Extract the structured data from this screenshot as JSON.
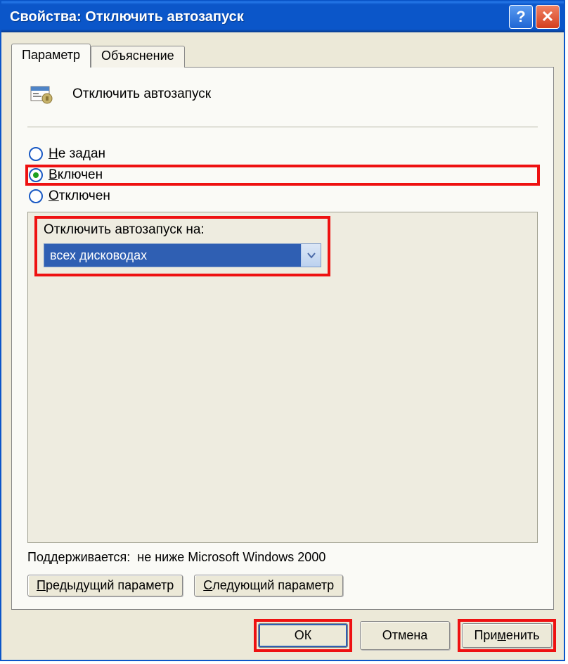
{
  "titlebar": {
    "text": "Свойства: Отключить автозапуск"
  },
  "tabs": {
    "parameter": "Параметр",
    "explanation": "Объяснение"
  },
  "policy": {
    "title": "Отключить автозапуск"
  },
  "radios": {
    "not_configured_prefix": "Н",
    "not_configured_rest": "е задан",
    "enabled_prefix": "В",
    "enabled_rest": "ключен",
    "disabled_prefix": "О",
    "disabled_rest": "тключен"
  },
  "settings": {
    "label": "Отключить автозапуск на:",
    "selected": "всех дисководах"
  },
  "supported": {
    "label": "Поддерживается:",
    "value": "не ниже Microsoft Windows 2000"
  },
  "nav": {
    "prev_prefix": "П",
    "prev_rest": "редыдущий параметр",
    "next_prefix": "С",
    "next_rest": "ледующий параметр"
  },
  "footer": {
    "ok": "ОК",
    "cancel": "Отмена",
    "apply_pre": "При",
    "apply_u": "м",
    "apply_post": "енить"
  }
}
